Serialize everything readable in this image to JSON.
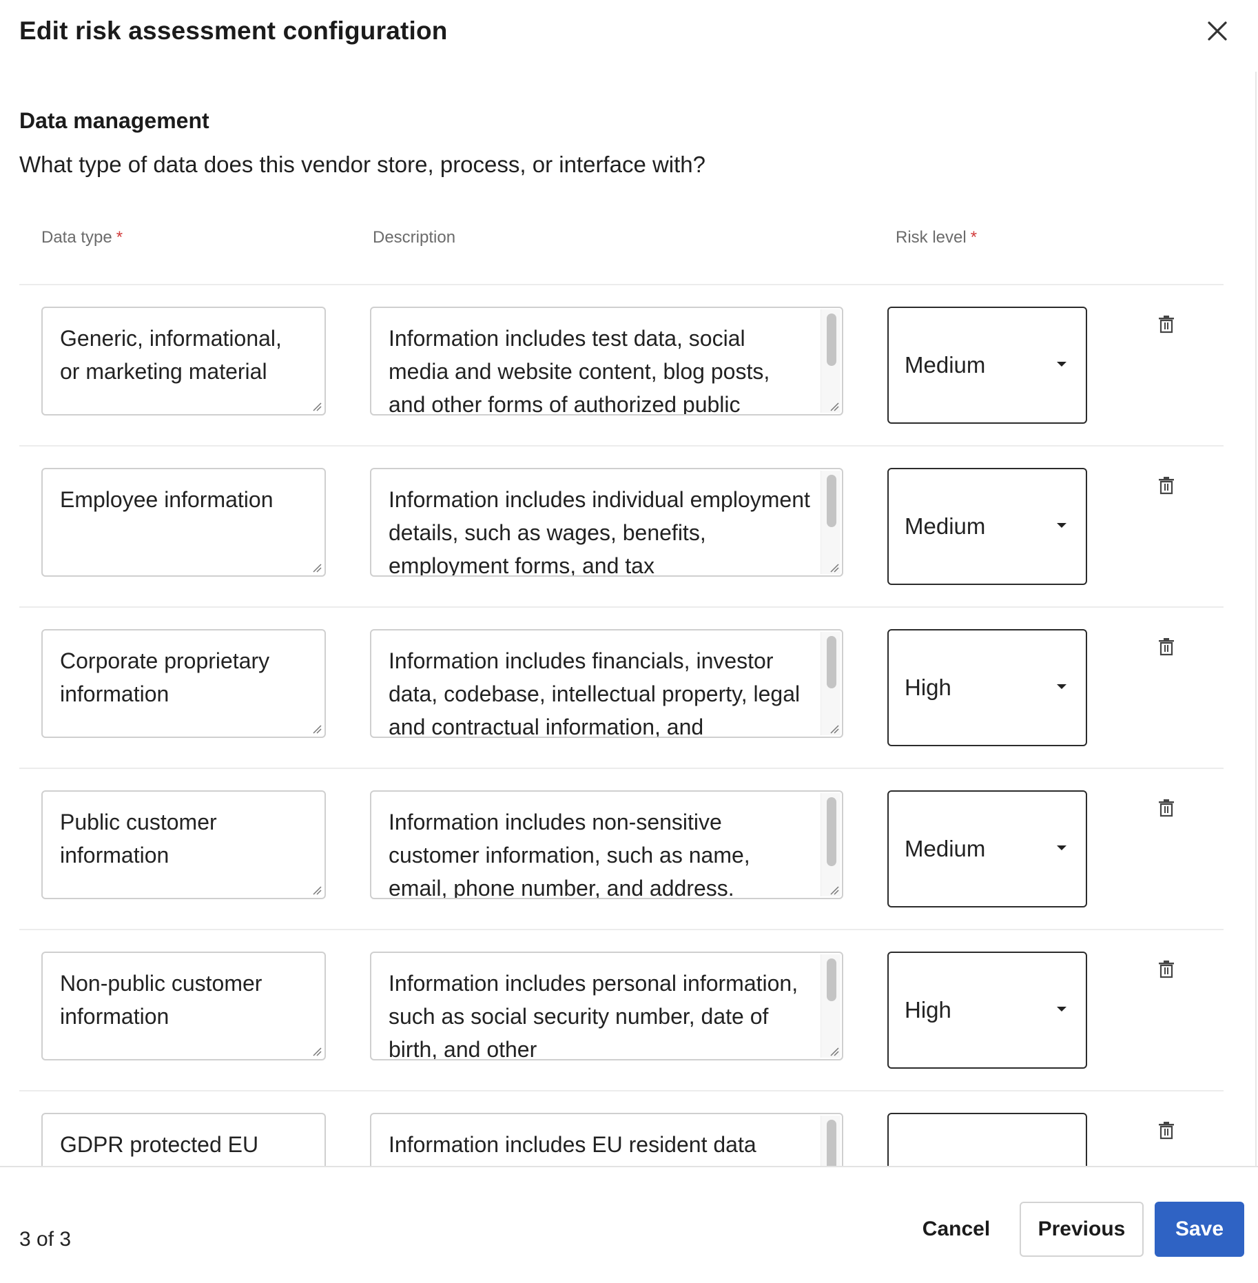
{
  "dialog": {
    "title": "Edit risk assessment configuration",
    "close_icon": "close-icon"
  },
  "section": {
    "title": "Data management",
    "question": "What type of data does this vendor store, process, or interface with?"
  },
  "columns": {
    "data_type": "Data type",
    "description": "Description",
    "risk_level": "Risk level",
    "required_marker": "*"
  },
  "rows": [
    {
      "data_type": "Generic, informational, or marketing material",
      "description": "Information includes test data, social media and website content, blog posts, and other forms of authorized public",
      "risk_level": "Medium"
    },
    {
      "data_type": "Employee information",
      "description": "Information includes individual employment details, such as wages, benefits, employment forms, and tax",
      "risk_level": "Medium"
    },
    {
      "data_type": "Corporate proprietary information",
      "description": "Information includes financials, investor data, codebase, intellectual property, legal and contractual information, and",
      "risk_level": "High"
    },
    {
      "data_type": "Public customer information",
      "description": "Information includes non-sensitive customer information, such as name, email, phone number, and address.",
      "risk_level": "Medium"
    },
    {
      "data_type": "Non-public customer information",
      "description": "Information includes personal information, such as social security number, date of birth, and other",
      "risk_level": "High"
    },
    {
      "data_type": "GDPR protected EU",
      "description": "Information includes EU resident data",
      "risk_level": ""
    }
  ],
  "footer": {
    "pager": "3 of 3",
    "cancel": "Cancel",
    "previous": "Previous",
    "save": "Save"
  },
  "colors": {
    "primary": "#2f63c4",
    "required": "#d13b3b"
  }
}
